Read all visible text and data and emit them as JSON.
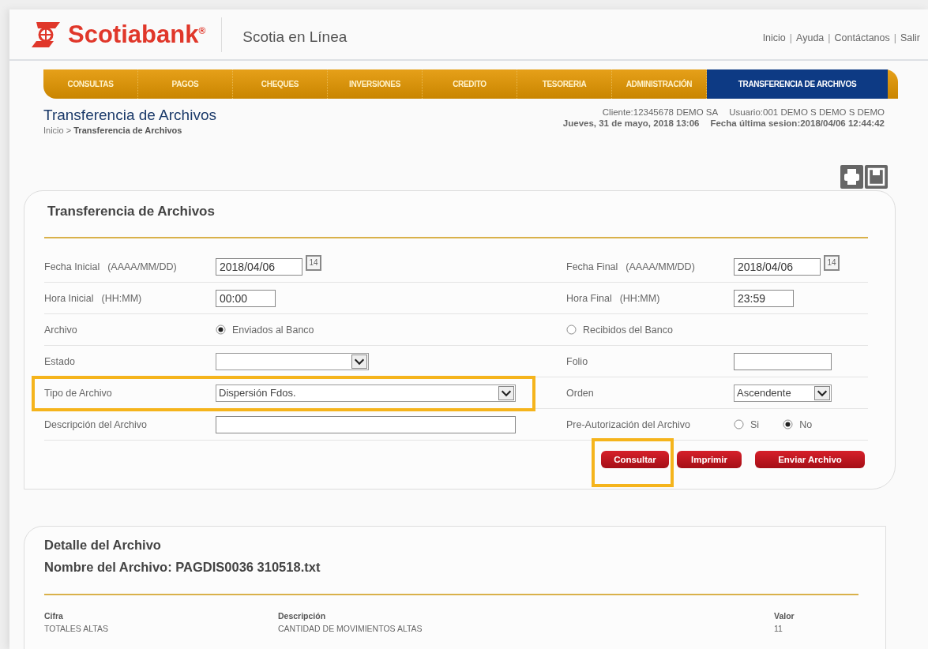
{
  "header": {
    "brand": "Scotiabank$^{®}$",
    "product": "Scotia en Línea",
    "links": [
      {
        "kind": "link",
        "label": "Inicio"
      },
      {
        "kind": "separator",
        "label": "|"
      },
      {
        "kind": "link",
        "label": "Ayuda"
      },
      {
        "kind": "separator",
        "label": "|"
      },
      {
        "kind": "link",
        "label": "Contáctanos"
      },
      {
        "kind": "separator",
        "label": "|"
      },
      {
        "kind": "link",
        "label": "Salir"
      }
    ]
  },
  "nav": [
    {
      "label": "CONSULTAS",
      "selected": false
    },
    {
      "label": "PAGOS",
      "selected": false
    },
    {
      "label": "CHEQUES",
      "selected": false
    },
    {
      "label": "INVERSIONES",
      "selected": false
    },
    {
      "label": "CREDITO",
      "selected": false
    },
    {
      "label": "TESORERIA",
      "selected": false
    },
    {
      "label": "ADMINISTRACIÓN",
      "selected": false
    },
    {
      "label": "TRANSFERENCIA DE ARCHIVOS",
      "selected": true
    }
  ],
  "page": {
    "title": "Transferencia de Archivos",
    "breadcrumb": [
      "Inicio",
      ">",
      "Transferencia de Archivos"
    ],
    "client": "Cliente:12345678  DEMO SA",
    "user": "Usuario:001 DEMO S DEMO S DEMO",
    "date": "Jueves, 31 de mayo, 2018 13:06",
    "last_session": "Fecha última sesion:2018/04/06 12:44:42"
  },
  "form": {
    "title": "Transferencia de Archivos",
    "rows": [
      {
        "left": {
          "kind": "date",
          "label": "Fecha Inicial",
          "hint": "(AAAA/MM/DD)",
          "value": "2018/04/06",
          "calendar": "14"
        },
        "right": {
          "kind": "date",
          "label": "Fecha Final",
          "hint": "(AAAA/MM/DD)",
          "value": "2018/04/06",
          "calendar": "14"
        }
      },
      {
        "left": {
          "kind": "time",
          "label": "Hora Inicial",
          "hint": "(HH:MM)",
          "value": "00:00"
        },
        "right": {
          "kind": "time",
          "label": "Hora Final",
          "hint": "(HH:MM)",
          "value": "23:59"
        }
      },
      {
        "left": {
          "kind": "radio",
          "label": "Archivo",
          "options": [
            {
              "label": "Enviados al Banco",
              "selected": true
            }
          ]
        },
        "right": {
          "kind": "radio",
          "options": [
            {
              "label": "Recibidos del Banco",
              "selected": false
            }
          ]
        }
      },
      {
        "left": {
          "kind": "select",
          "label": "Estado"
        },
        "right": {
          "kind": "text",
          "label": "Folio"
        }
      },
      {
        "left": {
          "kind": "select",
          "label": "Tipo de Archivo",
          "value": "Dispersión Fdos.",
          "highlighted": true
        },
        "right": {
          "kind": "select",
          "label": "Orden",
          "value": "Ascendente"
        }
      },
      {
        "left": {
          "kind": "text",
          "label": "Descripción del Archivo"
        },
        "right": {
          "kind": "radio",
          "label": "Pre-Autorización del Archivo",
          "options": [
            {
              "label": "Si",
              "selected": false
            },
            {
              "label": "No",
              "selected": true
            }
          ]
        }
      }
    ],
    "buttons": [
      {
        "label": "Consultar",
        "highlighted": true
      },
      {
        "label": "Imprimir",
        "highlighted": false
      },
      {
        "label": "Enviar Archivo",
        "highlighted": false
      }
    ]
  },
  "detail": {
    "title": "Detalle del Archivo",
    "file_name": "Nombre del Archivo: PAGDIS0036 310518.txt",
    "columns": [
      "Cifra",
      "Descripción",
      "Valor"
    ],
    "rows": [
      [
        "TOTALES ALTAS",
        "CANTIDAD DE MOVIMIENTOS ALTAS",
        "11"
      ]
    ]
  }
}
